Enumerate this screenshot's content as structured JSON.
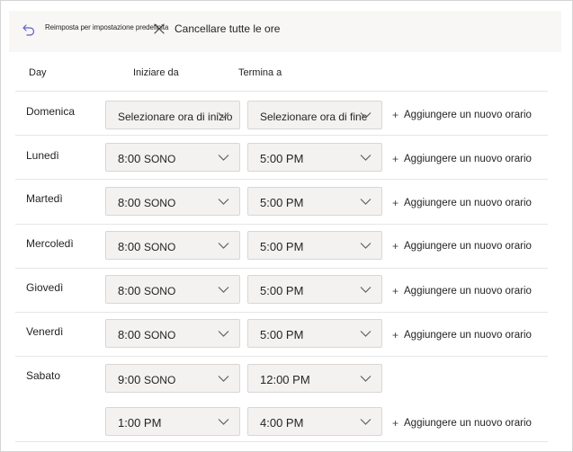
{
  "toolbar": {
    "reset_label": "Reimposta per impostazione predefinita",
    "clear_label": "Cancellare tutte le ore"
  },
  "columns": {
    "day": "Day",
    "start": "Iniziare da",
    "end": "Termina a"
  },
  "icons": {
    "reset": "undo-arrow-icon",
    "clear": "close-icon",
    "dropdown": "chevron-down-icon",
    "add": "plus-icon"
  },
  "add_label": "Aggiungere un nuovo orario",
  "rows": [
    {
      "day": "Domenica",
      "start": "Selezionare ora di inizio",
      "end": "Selezionare ora di fine"
    },
    {
      "day": "Lunedì",
      "start": "8:00",
      "start_suffix": "SONO",
      "end": "5:00 PM"
    },
    {
      "day": "Martedì",
      "start": "8:00",
      "start_suffix": "SONO",
      "end": "5:00 PM"
    },
    {
      "day": "Mercoledì",
      "start": "8:00",
      "start_suffix": "SONO",
      "end": "5:00 PM"
    },
    {
      "day": "Giovedì",
      "start": "8:00",
      "start_suffix": "SONO",
      "end": "5:00 PM"
    },
    {
      "day": "Venerdì",
      "start": "8:00",
      "start_suffix": "SONO",
      "end": "5:00 PM"
    },
    {
      "day": "Sabato",
      "start": "9:00",
      "start_suffix": "SONO",
      "end": "12:00 PM"
    },
    {
      "day": "",
      "start": "1:00 PM",
      "end": "4:00 PM"
    }
  ]
}
